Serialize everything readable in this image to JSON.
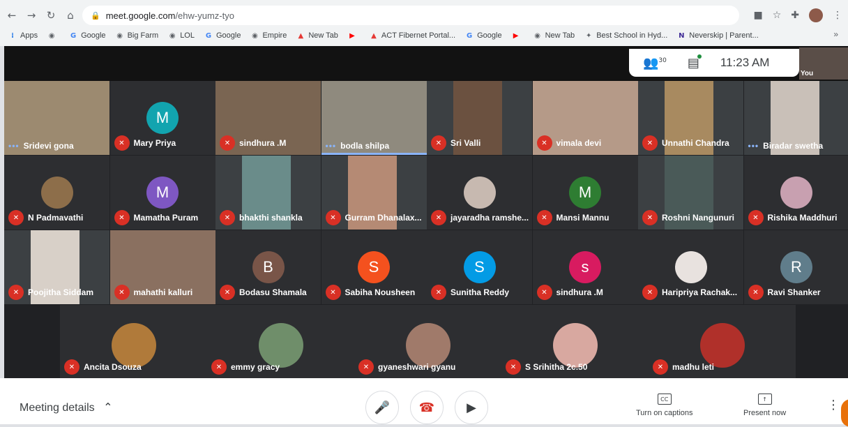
{
  "browser": {
    "url_host": "meet.google.com",
    "url_path": "/ehw-yumz-tyo",
    "bookmarks": [
      {
        "label": "Apps",
        "icon": "apps-grid-icon",
        "color": "#1a73e8"
      },
      {
        "label": "",
        "icon": "globe-icon",
        "color": "#5f6368"
      },
      {
        "label": "Google",
        "icon": "google-icon",
        "color": "#4285f4"
      },
      {
        "label": "Big Farm",
        "icon": "globe-icon",
        "color": "#5f6368"
      },
      {
        "label": "LOL",
        "icon": "globe-icon",
        "color": "#5f6368"
      },
      {
        "label": "Google",
        "icon": "google-icon",
        "color": "#4285f4"
      },
      {
        "label": "Empire",
        "icon": "globe-icon",
        "color": "#5f6368"
      },
      {
        "label": "New Tab",
        "icon": "act-icon",
        "color": "#e53935"
      },
      {
        "label": "",
        "icon": "youtube-icon",
        "color": "#ff0000"
      },
      {
        "label": "ACT Fibernet Portal...",
        "icon": "act-icon",
        "color": "#e53935"
      },
      {
        "label": "Google",
        "icon": "google-icon",
        "color": "#4285f4"
      },
      {
        "label": "",
        "icon": "youtube-icon",
        "color": "#ff0000"
      },
      {
        "label": "New Tab",
        "icon": "globe-icon",
        "color": "#5f6368"
      },
      {
        "label": "Best School in Hyd...",
        "icon": "school-icon",
        "color": "#5f6368"
      },
      {
        "label": "Neverskip | Parent...",
        "icon": "neverskip-icon",
        "color": "#3f2b96"
      }
    ],
    "bookmarks_more": "»"
  },
  "meet": {
    "participant_count": "30",
    "time": "11:23 AM",
    "self_label": "You",
    "tiles": [
      {
        "name": "Sridevi gona",
        "status": "dots",
        "kind": "video",
        "color": "#9c8a70"
      },
      {
        "name": "Mary Priya",
        "status": "muted",
        "kind": "avatar",
        "initial": "M",
        "color": "#12a4af"
      },
      {
        "name": "sindhura .M",
        "status": "muted",
        "kind": "video",
        "color": "#7a6552"
      },
      {
        "name": "bodla shilpa",
        "status": "dots",
        "kind": "video",
        "color": "#8f8a7e",
        "speaking": true
      },
      {
        "name": "Sri Valli",
        "status": "muted",
        "kind": "video",
        "color": "#6b5140"
      },
      {
        "name": "vimala devi",
        "status": "muted",
        "kind": "video",
        "color": "#b59a88"
      },
      {
        "name": "Unnathi Chandra",
        "status": "muted",
        "kind": "video",
        "color": "#a88a60"
      },
      {
        "name": "Biradar swetha",
        "status": "dots",
        "kind": "video",
        "color": "#c9c0b8"
      },
      {
        "name": "N Padmavathi",
        "status": "muted",
        "kind": "photo",
        "color": "#8d6e4a"
      },
      {
        "name": "Mamatha Puram",
        "status": "muted",
        "kind": "avatar",
        "initial": "M",
        "color": "#7e57c2"
      },
      {
        "name": "bhakthi shankla",
        "status": "muted",
        "kind": "video",
        "color": "#6a8c8a"
      },
      {
        "name": "Gurram Dhanalax...",
        "status": "muted",
        "kind": "video",
        "color": "#b58a74"
      },
      {
        "name": "jayaradha ramshe...",
        "status": "muted",
        "kind": "photo",
        "color": "#c7b9b0"
      },
      {
        "name": "Mansi Mannu",
        "status": "muted",
        "kind": "avatar",
        "initial": "M",
        "color": "#2e7d32"
      },
      {
        "name": "Roshni Nangunuri",
        "status": "muted",
        "kind": "video",
        "color": "#4a5a58"
      },
      {
        "name": "Rishika Maddhuri",
        "status": "muted",
        "kind": "photo",
        "color": "#c8a0b0"
      },
      {
        "name": "Poojitha Siddam",
        "status": "muted",
        "kind": "video",
        "color": "#d8d0c8"
      },
      {
        "name": "mahathi kalluri",
        "status": "muted",
        "kind": "video",
        "color": "#8a7060"
      },
      {
        "name": "Bodasu Shamala",
        "status": "muted",
        "kind": "avatar",
        "initial": "B",
        "color": "#795548"
      },
      {
        "name": "Sabiha Nousheen",
        "status": "muted",
        "kind": "avatar",
        "initial": "S",
        "color": "#f4511e"
      },
      {
        "name": "Sunitha Reddy",
        "status": "muted",
        "kind": "avatar",
        "initial": "S",
        "color": "#039be5"
      },
      {
        "name": "sindhura .M",
        "status": "muted",
        "kind": "avatar",
        "initial": "s",
        "color": "#d81b60"
      },
      {
        "name": "Haripriya Rachak...",
        "status": "muted",
        "kind": "photo",
        "color": "#e8e2df"
      },
      {
        "name": "Ravi Shanker",
        "status": "muted",
        "kind": "avatar",
        "initial": "R",
        "color": "#607d8b"
      },
      {
        "name": "Ancita Dsouza",
        "status": "muted",
        "kind": "photo",
        "color": "#b07a3a"
      },
      {
        "name": "emmy gracy",
        "status": "muted",
        "kind": "photo",
        "color": "#6f8e6a"
      },
      {
        "name": "gyaneshwari gyanu",
        "status": "muted",
        "kind": "photo",
        "color": "#a07a6a"
      },
      {
        "name": "S Srihitha 2c.50",
        "status": "muted",
        "kind": "photo",
        "color": "#d8a8a0"
      },
      {
        "name": "madhu leti",
        "status": "muted",
        "kind": "photo",
        "color": "#b0302a"
      }
    ]
  },
  "bottom": {
    "meeting_details": "Meeting details",
    "captions_label": "Turn on captions",
    "present_label": "Present now"
  }
}
